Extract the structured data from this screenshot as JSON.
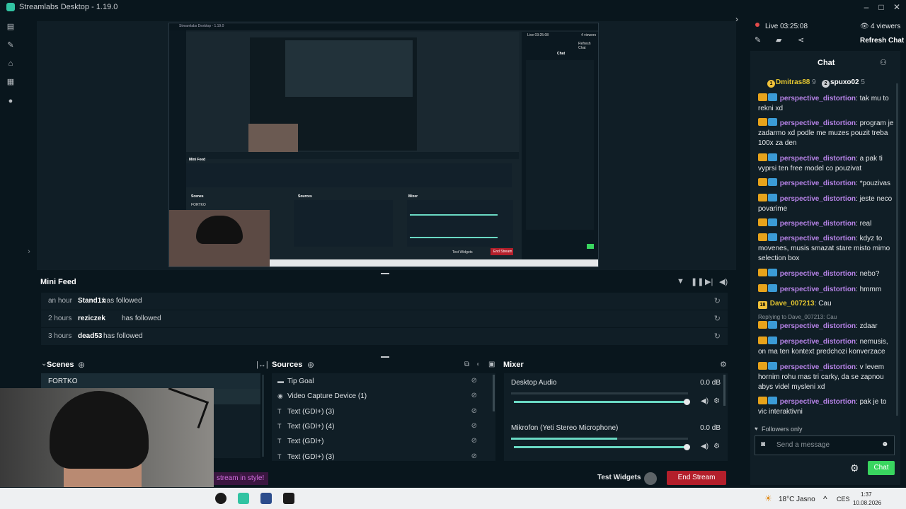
{
  "window": {
    "title": "Streamlabs Desktop - 1.19.0"
  },
  "nav": {
    "icons": [
      "file-icon",
      "theme-icon",
      "store-icon",
      "video-icon",
      "record-icon"
    ]
  },
  "preview": {
    "inner_title": "Streamlabs Desktop - 1.19.0",
    "mini_feed_label": "Mini Feed",
    "scenes_label": "Scenes",
    "sources_label": "Sources",
    "mixer_label": "Mixer",
    "scene_item": "FORTKO",
    "test_widgets": "Test Widgets",
    "end_stream": "End Stream",
    "chat_live": "Live 03:25:08",
    "chat_viewers": "4 viewers",
    "chat_refresh": "Refresh Chat",
    "chat_title": "Chat"
  },
  "minifeed": {
    "title": "Mini Feed",
    "rows": [
      {
        "time": "an hour",
        "user": "Stand1x",
        "action": "has followed"
      },
      {
        "time": "2 hours",
        "user": "reziczek",
        "action": "has followed"
      },
      {
        "time": "3 hours",
        "user": "dead53",
        "action": "has followed"
      }
    ]
  },
  "scenes": {
    "title": "Scenes",
    "items": [
      "FORTKO"
    ]
  },
  "sources": {
    "title": "Sources",
    "items": [
      {
        "label": "Tip Goal",
        "icon": "folder-icon"
      },
      {
        "label": "Video Capture Device (1)",
        "icon": "webcam-icon"
      },
      {
        "label": "Text (GDI+) (3)",
        "icon": "text-icon"
      },
      {
        "label": "Text (GDI+) (4)",
        "icon": "text-icon"
      },
      {
        "label": "Text (GDI+)",
        "icon": "text-icon"
      },
      {
        "label": "Text (GDI+) (3)",
        "icon": "text-icon"
      }
    ]
  },
  "mixer": {
    "title": "Mixer",
    "channels": [
      {
        "name": "Desktop Audio",
        "db": "0.0 dB",
        "level": 1.0
      },
      {
        "name": "Mikrofon (Yeti Stereo Microphone)",
        "db": "0.0 dB",
        "level": 1.0
      }
    ]
  },
  "footer": {
    "promo": "stream in style!",
    "test_widgets": "Test Widgets",
    "end_stream": "End Stream"
  },
  "chat": {
    "live": "Live 03:25:08",
    "viewers": "4 viewers",
    "refresh": "Refresh Chat",
    "title": "Chat",
    "top_users": [
      {
        "rank": "1",
        "name": "Dmitras88",
        "count": "9"
      },
      {
        "rank": "2",
        "name": "spuxo02",
        "count": "5"
      }
    ],
    "messages": [
      {
        "user": "perspective_distortion",
        "text": "tak mu to rekni xd"
      },
      {
        "user": "perspective_distortion",
        "text": "program je zadarmo xd podle me muzes pouzit treba 100x za den"
      },
      {
        "user": "perspective_distortion",
        "text": "a pak ti vyprsi ten free model co pouzivat"
      },
      {
        "user": "perspective_distortion",
        "text": "*pouzivas"
      },
      {
        "user": "perspective_distortion",
        "text": "jeste neco povarime"
      },
      {
        "user": "perspective_distortion",
        "text": "real"
      },
      {
        "user": "perspective_distortion",
        "text": "kdyz to movenes, musis smazat stare misto mimo selection box"
      },
      {
        "user": "perspective_distortion",
        "text": "nebo?"
      },
      {
        "user": "perspective_distortion",
        "text": "hmmm"
      },
      {
        "user": "Dave_007213",
        "text": "Cau",
        "badge": "18"
      },
      {
        "user": "perspective_distortion",
        "text": "zdaar",
        "reply": "Replying to Dave_007213: Cau"
      },
      {
        "user": "perspective_distortion",
        "text": "nemusis, on ma ten kontext predchozi konverzace"
      },
      {
        "user": "perspective_distortion",
        "text": "v levem hornim rohu mas tri carky, da se zapnou abys videl mysleni xd"
      },
      {
        "user": "perspective_distortion",
        "text": "pak je to vic interaktivni"
      }
    ],
    "followers_only": "Followers only",
    "input_placeholder": "Send a message",
    "send_label": "Chat"
  },
  "taskbar": {
    "weather": "18°C",
    "weather_desc": "Jasno",
    "language": "CES",
    "time": "1:37",
    "date": "10.08.2026"
  }
}
